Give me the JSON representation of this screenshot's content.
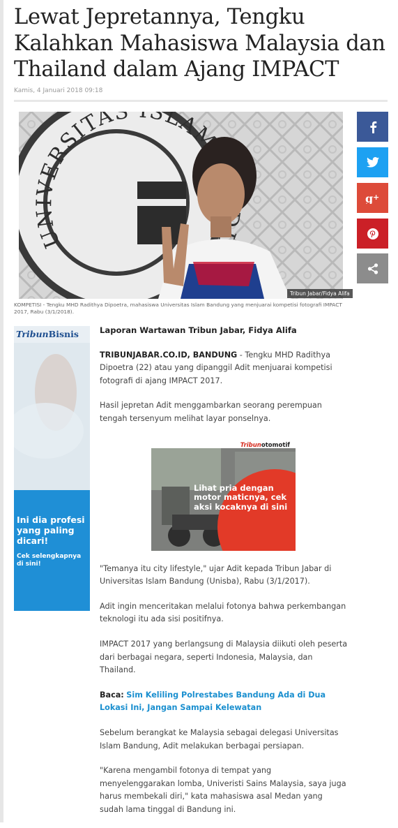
{
  "article": {
    "title": "Lewat Jepretannya, Tengku Kalahkan Mahasiswa Malaysia dan Thailand dalam Ajang IMPACT",
    "date": "Kamis, 4 Januari 2018 09:18",
    "photo_credit": "Tribun Jabar/Fidya Alifa",
    "caption": "KOMPETISI - Tengku MHD Radithya Dipoetra, mahasiswa Universitas Islam Bandung yang menjuarai kompetisi fotografi IMPACT 2017, Rabu (3/1/2018).",
    "reporter": "Laporan Wartawan Tribun Jabar, Fidya Alifa",
    "dateline": "TRIBUNJABAR.CO.ID, BANDUNG",
    "p1_rest": " - Tengku MHD Radithya Dipoetra (22) atau yang dipanggil Adit menjuarai kompetisi fotografi di ajang IMPACT 2017.",
    "p2": "Hasil jepretan Adit menggambarkan seorang perempuan tengah tersenyum melihat layar ponselnya.",
    "p3": "\"Temanya itu city lifestyle,\" ujar Adit kepada Tribun Jabar di Universitas Islam Bandung (Unisba), Rabu (3/1/2017).",
    "p4": "Adit ingin menceritakan melalui fotonya bahwa perkembangan teknologi itu ada sisi positifnya.",
    "p5": "IMPACT 2017 yang berlangsung di Malaysia diikuti oleh peserta dari berbagai negara, seperti Indonesia, Malaysia, dan Thailand.",
    "baca_label": "Baca:",
    "baca_link": "Sim Keliling Polrestabes Bandung Ada di Dua Lokasi Ini, Jangan Sampai Kelewatan",
    "p6": "Sebelum berangkat ke Malaysia sebagai delegasi Universitas Islam Bandung, Adit melakukan berbagai persiapan.",
    "p7": "\"Karena mengambil fotonya di tempat yang menyelenggarakan lomba, Univeristi Sains Malaysia, saya juga harus membekali diri,\" kata mahasiswa asal Medan yang sudah lama tinggal di Bandung ini."
  },
  "photo_wall_text": "UNIVERSITAS ISLAM BANDUNG",
  "ads": {
    "left": {
      "brand_a": "Tribun",
      "brand_b": "Bisnis",
      "headline": "Ini dia profesi yang paling dicari!",
      "cta": "Cek selengkapnya di sini!"
    },
    "mid": {
      "brand_a": "Tribun",
      "brand_b": "otomotif",
      "text": "Lihat pria dengan motor maticnya, cek aksi kocaknya di sini"
    }
  },
  "share": [
    {
      "network": "facebook",
      "icon": "facebook-icon",
      "color": "#3b5998"
    },
    {
      "network": "twitter",
      "icon": "twitter-icon",
      "color": "#1da1f2"
    },
    {
      "network": "google-plus",
      "icon": "google-plus-icon",
      "color": "#dd4b39"
    },
    {
      "network": "pinterest",
      "icon": "pinterest-icon",
      "color": "#cb2027"
    },
    {
      "network": "share",
      "icon": "share-icon",
      "color": "#8c8c8c"
    }
  ],
  "colors": {
    "link": "#1a8fcf",
    "date": "#999999"
  }
}
